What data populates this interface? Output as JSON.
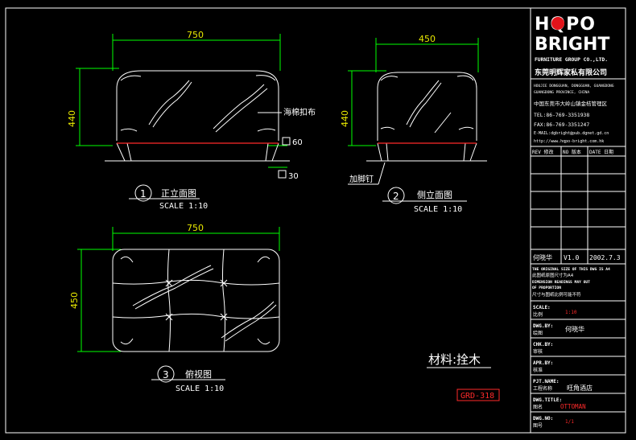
{
  "front_view": {
    "dim_width": "750",
    "dim_height": "440",
    "callout_button": "海棉扣布",
    "dim_leg": "60",
    "dim_leg_bottom": "30",
    "label_number": "1",
    "label_title": "正立面图",
    "scale": "SCALE 1:10"
  },
  "side_view": {
    "dim_width": "450",
    "dim_height": "440",
    "callout_nail": "加脚钉",
    "label_number": "2",
    "label_title": "侧立面图",
    "scale": "SCALE 1:10"
  },
  "top_view": {
    "dim_width": "750",
    "dim_height": "450",
    "label_number": "3",
    "label_title": "俯视图",
    "scale": "SCALE 1:10"
  },
  "material": "材料:拴木",
  "drawing_code": "GRD-318",
  "title_block": {
    "logo_top": "HQPO",
    "logo_bottom": "BRIGHT",
    "company_en": "FURNITURE GROUP CO.,LTD.",
    "company_cn": "东莞明辉家私有限公司",
    "address_en_1": "HOUJIE DONGGUAN, DONGGUAN, GUANGDONG",
    "address_en_2": "GUANGDONG PROVINCE, CHINA",
    "address_cn": "中国东莞市大岭山镇金桔管理区",
    "tel": "TEL:86-769-3351938",
    "fax": "FAX:86-769-3351247",
    "email": "E-MAIL:dgbright@pub.dgnet.gd.cn",
    "web": "http://www.hqpo-bright.com.hk",
    "rev_headers": [
      "REV 修改",
      "NO 版本",
      "DATE 日期"
    ],
    "rev_entry": {
      "name": "何晓华",
      "version": "V1.0",
      "date": "2002.7.3"
    },
    "note_en_1": "THE ORIGINAL SIZE OF THIS DWG IS A4",
    "note_cn_1": "此图纸原图尺寸为A4",
    "note_en_2": "DIMENSION READINGS MAY OUT",
    "note_en_3": "OF PROPORTION",
    "note_cn_2": "尺寸与图纸比例可能不符",
    "scale_label_en": "SCALE:",
    "scale_label_cn": "比例",
    "scale_value": "1:10",
    "dwg_by_en": "DWG.BY:",
    "dwg_by_cn": "绘图",
    "dwg_by_value": "何晓华",
    "chk_by_en": "CHK.BY:",
    "chk_by_cn": "审核",
    "apr_by_en": "APR.BY:",
    "apr_by_cn": "核准",
    "pjt_name_en": "PJT.NAME:",
    "pjt_name_cn": "工程名称",
    "pjt_name_value": "旺角酒店",
    "dwg_title_en": "DWG.TITLE:",
    "dwg_title_cn": "图名",
    "dwg_title_value": "OTTOMAN",
    "dwg_no_en": "DWG.NO:",
    "dwg_no_cn": "图号",
    "dwg_no_value": "1/1"
  },
  "colors": {
    "background": "#000000",
    "linework": "#ffffff",
    "dimension": "#00ff00",
    "dimension_text": "#e8e800",
    "accent": "#ff2a2a",
    "logo_o": "#e0131a"
  }
}
